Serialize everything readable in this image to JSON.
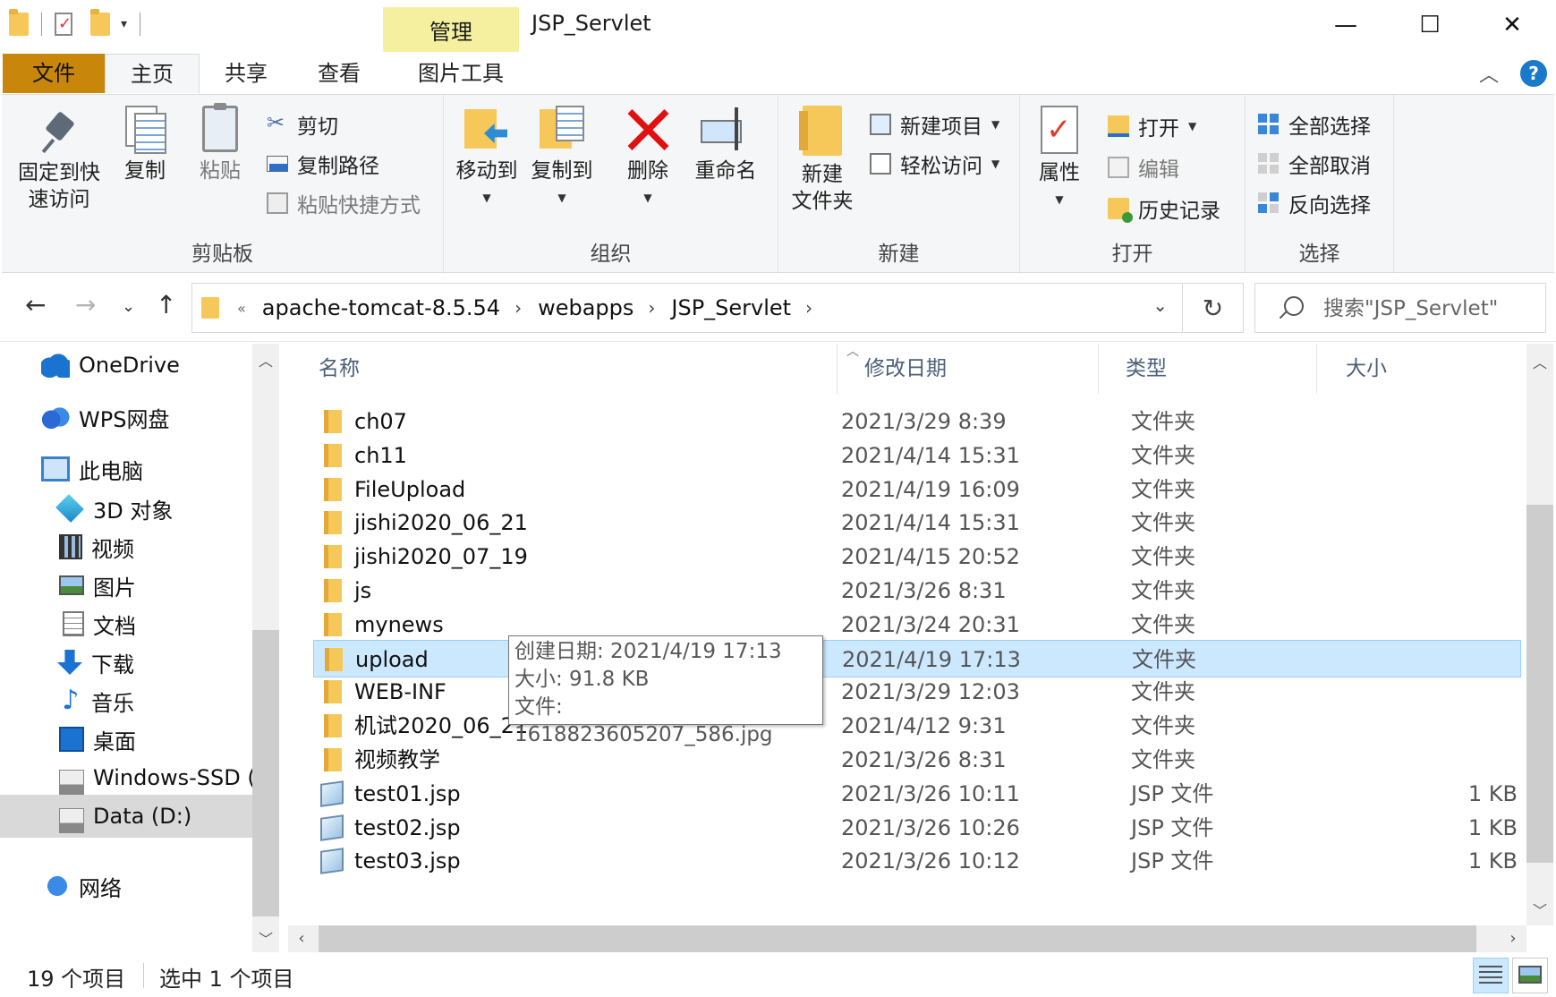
{
  "window": {
    "title": "JSP_Servlet",
    "context_tab": "管理",
    "minimize": "—",
    "maximize": "☐",
    "close": "✕"
  },
  "ribbon_tabs": {
    "file": "文件",
    "home": "主页",
    "share": "共享",
    "view": "查看",
    "picture_tools": "图片工具",
    "help": "?",
    "collapse": "︿"
  },
  "ribbon": {
    "clipboard": {
      "label": "剪贴板",
      "pin": "固定到快\n速访问",
      "pin_line1": "固定到快",
      "pin_line2": "速访问",
      "copy": "复制",
      "paste": "粘贴",
      "cut": "剪切",
      "copy_path": "复制路径",
      "paste_shortcut": "粘贴快捷方式"
    },
    "organize": {
      "label": "组织",
      "move_to": "移动到",
      "copy_to": "复制到",
      "delete": "删除",
      "rename": "重命名"
    },
    "new": {
      "label": "新建",
      "new_folder_line1": "新建",
      "new_folder_line2": "文件夹",
      "new_item": "新建项目",
      "easy_access": "轻松访问"
    },
    "open": {
      "label": "打开",
      "properties": "属性",
      "open": "打开",
      "edit": "编辑",
      "history": "历史记录"
    },
    "select": {
      "label": "选择",
      "select_all": "全部选择",
      "select_none": "全部取消",
      "invert": "反向选择"
    }
  },
  "address": {
    "breadcrumb_lead": "«",
    "crumbs": [
      "apache-tomcat-8.5.54",
      "webapps",
      "JSP_Servlet"
    ],
    "search_placeholder": "搜索\"JSP_Servlet\""
  },
  "nav_pane": {
    "items": [
      {
        "label": "OneDrive"
      },
      {
        "label": "WPS网盘"
      },
      {
        "label": "此电脑"
      },
      {
        "label": "3D 对象"
      },
      {
        "label": "视频"
      },
      {
        "label": "图片"
      },
      {
        "label": "文档"
      },
      {
        "label": "下载"
      },
      {
        "label": "音乐"
      },
      {
        "label": "桌面"
      },
      {
        "label": "Windows-SSD ("
      },
      {
        "label": "Data (D:)"
      },
      {
        "label": "网络"
      }
    ]
  },
  "file_list": {
    "columns": {
      "name": "名称",
      "date": "修改日期",
      "type": "类型",
      "size": "大小"
    },
    "rows": [
      {
        "name": "ch07",
        "date": "2021/3/29 8:39",
        "type": "文件夹",
        "size": ""
      },
      {
        "name": "ch11",
        "date": "2021/4/14 15:31",
        "type": "文件夹",
        "size": ""
      },
      {
        "name": "FileUpload",
        "date": "2021/4/19 16:09",
        "type": "文件夹",
        "size": ""
      },
      {
        "name": "jishi2020_06_21",
        "date": "2021/4/14 15:31",
        "type": "文件夹",
        "size": ""
      },
      {
        "name": "jishi2020_07_19",
        "date": "2021/4/15 20:52",
        "type": "文件夹",
        "size": ""
      },
      {
        "name": "js",
        "date": "2021/3/26 8:31",
        "type": "文件夹",
        "size": ""
      },
      {
        "name": "mynews",
        "date": "2021/3/24 20:31",
        "type": "文件夹",
        "size": ""
      },
      {
        "name": "upload",
        "date": "2021/4/19 17:13",
        "type": "文件夹",
        "size": ""
      },
      {
        "name": "WEB-INF",
        "date": "2021/3/29 12:03",
        "type": "文件夹",
        "size": ""
      },
      {
        "name": "机试2020_06_21",
        "date": "2021/4/12 9:31",
        "type": "文件夹",
        "size": ""
      },
      {
        "name": "视频教学",
        "date": "2021/3/26 8:31",
        "type": "文件夹",
        "size": ""
      },
      {
        "name": "test01.jsp",
        "date": "2021/3/26 10:11",
        "type": "JSP 文件",
        "size": "1 KB"
      },
      {
        "name": "test02.jsp",
        "date": "2021/3/26 10:26",
        "type": "JSP 文件",
        "size": "1 KB"
      },
      {
        "name": "test03.jsp",
        "date": "2021/3/26 10:12",
        "type": "JSP 文件",
        "size": "1 KB"
      }
    ],
    "tooltip": {
      "created": "创建日期: 2021/4/19 17:13",
      "size": "大小: 91.8 KB",
      "file": "文件: 1618823605207_586.jpg"
    }
  },
  "status": {
    "item_count": "19 个项目",
    "selected": "选中 1 个项目"
  }
}
